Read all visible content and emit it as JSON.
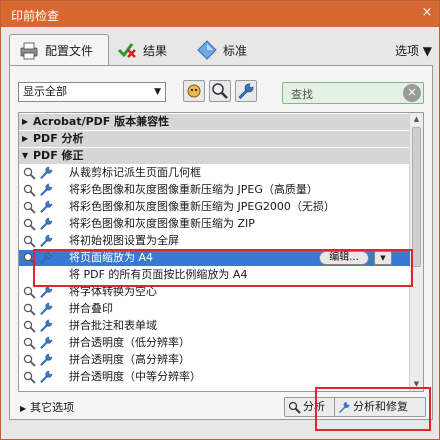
{
  "window": {
    "title": "印前检查",
    "close_label": "×"
  },
  "tabs": [
    {
      "label": "配置文件"
    },
    {
      "label": "结果"
    },
    {
      "label": "标准"
    }
  ],
  "options_label": "选项 ▼",
  "toolbar": {
    "filter_value": "显示全部",
    "search_placeholder": "查找"
  },
  "list": {
    "categories": [
      {
        "label": "Acrobat/PDF 版本兼容性",
        "expanded": false
      },
      {
        "label": "PDF 分析",
        "expanded": false
      },
      {
        "label": "PDF 修正",
        "expanded": true
      }
    ],
    "items": [
      {
        "label": "从裁剪标记派生页面几何框"
      },
      {
        "label": "将彩色图像和灰度图像重新压缩为 JPEG（高质量）"
      },
      {
        "label": "将彩色图像和灰度图像重新压缩为 JPEG2000（无损）"
      },
      {
        "label": "将彩色图像和灰度图像重新压缩为 ZIP"
      },
      {
        "label": "将初始视图设置为全屏"
      },
      {
        "label": "将页面缩放为 A4",
        "selected": true,
        "edit_label": "编辑...",
        "description": "将 PDF 的所有页面按比例缩放为 A4"
      },
      {
        "label": "将字体转换为空心"
      },
      {
        "label": "拼合叠印"
      },
      {
        "label": "拼合批注和表单域"
      },
      {
        "label": "拼合透明度（低分辨率）"
      },
      {
        "label": "拼合透明度（高分辨率）"
      },
      {
        "label": "拼合透明度（中等分辨率）"
      }
    ]
  },
  "footer": {
    "more_label": "其它选项",
    "analyze_label": "分析",
    "analyze_fix_label": "分析和修复"
  },
  "colors": {
    "title_bar": "#d7682f",
    "selection": "#3a78d6",
    "highlight_box": "#e3242b"
  }
}
